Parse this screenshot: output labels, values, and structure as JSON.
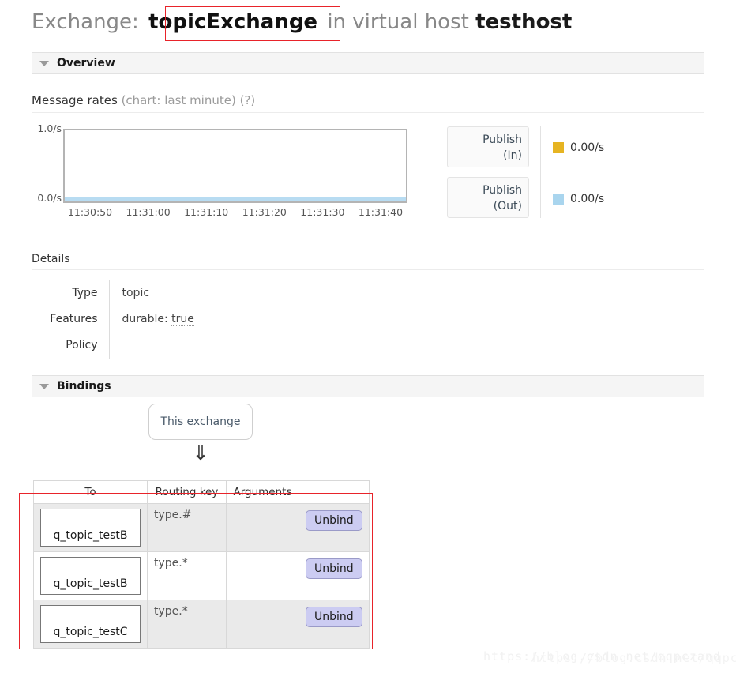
{
  "page": {
    "title_prefix": "Exchange:",
    "exchange_name": "topicExchange",
    "title_middle": "in virtual host",
    "vhost": "testhost"
  },
  "overview": {
    "section_label": "Overview",
    "rates_label": "Message rates",
    "rates_note": "(chart: last minute) (?)",
    "help_label": "(?)"
  },
  "chart_data": {
    "type": "line",
    "title": "Message rates (chart: last minute)",
    "xlabel": "",
    "ylabel": "",
    "ylim": [
      0.0,
      1.0
    ],
    "ytick_labels": [
      "1.0/s",
      "0.0/s"
    ],
    "x": [
      "11:30:50",
      "11:31:00",
      "11:31:10",
      "11:31:20",
      "11:31:30",
      "11:31:40"
    ],
    "grid": false,
    "legend_position": "right",
    "series": [
      {
        "name": "Publish (In)",
        "current": "0.00/s",
        "color": "#e6b422",
        "values": [
          0.0,
          0.0,
          0.0,
          0.0,
          0.0,
          0.0
        ]
      },
      {
        "name": "Publish (Out)",
        "current": "0.00/s",
        "color": "#a9d5ee",
        "values": [
          0.0,
          0.0,
          0.0,
          0.0,
          0.0,
          0.0
        ]
      }
    ]
  },
  "legend": {
    "publish_in_label_line1": "Publish",
    "publish_in_label_line2": "(In)",
    "publish_out_label_line1": "Publish",
    "publish_out_label_line2": "(Out)",
    "publish_in_rate": "0.00/s",
    "publish_out_rate": "0.00/s",
    "publish_in_color": "#e6b422",
    "publish_out_color": "#a9d5ee"
  },
  "details": {
    "heading": "Details",
    "rows": [
      {
        "label": "Type",
        "value": "topic"
      },
      {
        "label": "Features",
        "value_prefix": "durable: ",
        "value_dotted": "true"
      },
      {
        "label": "Policy",
        "value": ""
      }
    ]
  },
  "bindings": {
    "section_label": "Bindings",
    "source_box_label": "This exchange",
    "arrow_glyph": "⇓",
    "columns": [
      "To",
      "Routing key",
      "Arguments",
      ""
    ],
    "rows": [
      {
        "to": "q_topic_testB",
        "routing_key": "type.#",
        "arguments": "",
        "action": "Unbind"
      },
      {
        "to": "q_topic_testB",
        "routing_key": "type.*",
        "arguments": "",
        "action": "Unbind"
      },
      {
        "to": "q_topic_testC",
        "routing_key": "type.*",
        "arguments": "",
        "action": "Unbind"
      }
    ]
  },
  "annotations": {
    "highlight_color": "#e8232a"
  },
  "watermark": {
    "text": "https://blog.csdn.net/qqpczand"
  }
}
